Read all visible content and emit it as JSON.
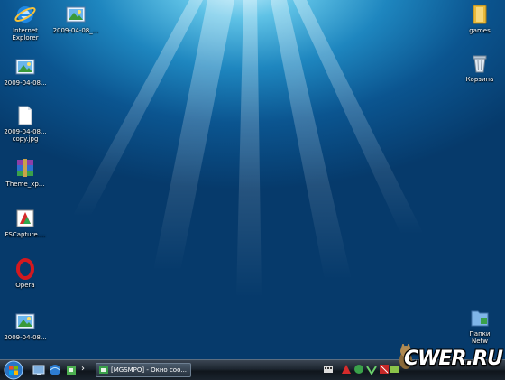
{
  "desktop": {
    "icons_left": [
      {
        "label": "Internet\nExplorer",
        "icon": "internet-explorer-icon"
      },
      {
        "label": "2009-04-08...",
        "icon": "image-file-icon"
      },
      {
        "label": "2009-04-08...\ncopy.jpg",
        "icon": "blank-file-icon"
      },
      {
        "label": "Theme_xp...",
        "icon": "winrar-archive-icon"
      },
      {
        "label": "FSCapture....",
        "icon": "fscapture-icon"
      },
      {
        "label": "Opera",
        "icon": "opera-icon"
      },
      {
        "label": "2009-04-08...",
        "icon": "image-file-icon"
      }
    ],
    "icon_top_second_column": {
      "label": "2009-04-08_...",
      "icon": "image-file-icon"
    },
    "icons_right": [
      {
        "label": "games",
        "icon": "folder-icon"
      },
      {
        "label": "Корзина",
        "icon": "recycle-bin-icon"
      },
      {
        "label": "Папки\nNetw",
        "icon": "network-folder-icon"
      }
    ]
  },
  "taskbar": {
    "start_icon": "windows-start-orb-icon",
    "quick_launch": [
      "show-desktop-icon",
      "network-icon",
      "shortcut-icon"
    ],
    "overflow_label": "›",
    "active_task": {
      "label": "[MGSMPO] - Окно соо...",
      "icon": "chat-window-icon"
    },
    "tray_icons": [
      "keyboard-icon",
      "antivirus-icon",
      "shield-icon",
      "torrent-icon",
      "volume-icon",
      "network-status-icon",
      "clock-icon"
    ]
  },
  "watermark": {
    "text": "CWER.RU",
    "mascot_icon": "coyote-mascot-icon"
  },
  "colors": {
    "desktop_top": "#cdf3ff",
    "desktop_bottom": "#063a6b",
    "taskbar": "#1d2630"
  }
}
